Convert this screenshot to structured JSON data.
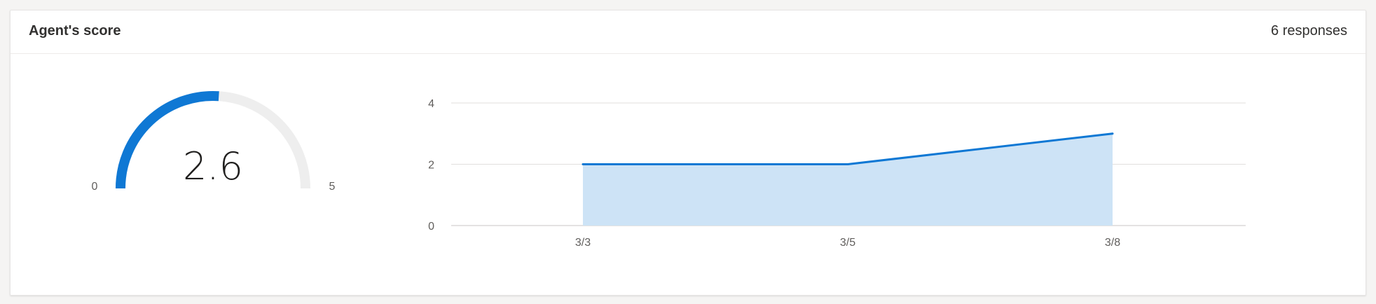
{
  "card": {
    "title": "Agent's score",
    "responses": "6 responses"
  },
  "gauge": {
    "value": 2.6,
    "value_label": "2.6",
    "min_label": "0",
    "max_label": "5",
    "min": 0,
    "max": 5,
    "fill_color": "#0f78d4",
    "track_color": "#eeeeee"
  },
  "chart_data": {
    "type": "area",
    "title": "",
    "xlabel": "",
    "ylabel": "",
    "categories": [
      "3/3",
      "3/5",
      "3/8"
    ],
    "values": [
      2,
      2,
      3
    ],
    "ylim": [
      0,
      4
    ],
    "yticks": [
      0,
      2,
      4
    ],
    "grid": true,
    "line_color": "#0f78d4",
    "fill_color": "#cde3f6",
    "gridline_color": "#e1dfdd"
  }
}
